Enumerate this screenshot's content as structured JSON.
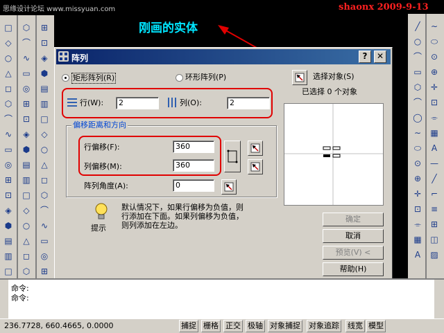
{
  "watermark": {
    "left_text": "思缘设计论坛 www.missyuan.com",
    "author_date": "shaonx 2009-9-13"
  },
  "annotation": {
    "callout": "刚画的实体"
  },
  "dialog": {
    "title": "阵列",
    "help_btn": "?",
    "close_btn": "✕",
    "rect_array": "矩形阵列(R)",
    "polar_array": "环形阵列(P)",
    "select_objects_label": "选择对象(S)",
    "selected_count": "已选择 0 个对象",
    "rows_label": "行(W):",
    "rows_value": "2",
    "cols_label": "列(O):",
    "cols_value": "2",
    "offset_group_title": "偏移距离和方向",
    "row_offset_label": "行偏移(F):",
    "row_offset_value": "360",
    "col_offset_label": "列偏移(M):",
    "col_offset_value": "360",
    "angle_label": "阵列角度(A):",
    "angle_value": "0",
    "tip_text_1": "默认情况下，如果行偏移为负值，则",
    "tip_text_2": "行添加在下面。如果列偏移为负值，",
    "tip_text_3": "则列添加在左边。",
    "tip_label": "提示",
    "ok_btn": "确定",
    "cancel_btn": "取消",
    "preview_btn": "预览(V) <",
    "help_button": "帮助(H)"
  },
  "command_line": {
    "line1": "命令:",
    "line2": "命令:"
  },
  "status_bar": {
    "coords": "236.7728, 660.4665, 0.0000",
    "snap": "捕捉",
    "grid": "栅格",
    "ortho": "正交",
    "polar": "极轴",
    "osnap": "对象捕捉",
    "otrack": "对象追踪",
    "lwt": "线宽",
    "model": "模型"
  },
  "colors": {
    "title_start": "#0a246a",
    "title_end": "#3a6ea5",
    "annotation": "#00e5ff",
    "red": "#e00000",
    "group_title": "#0046d5"
  }
}
